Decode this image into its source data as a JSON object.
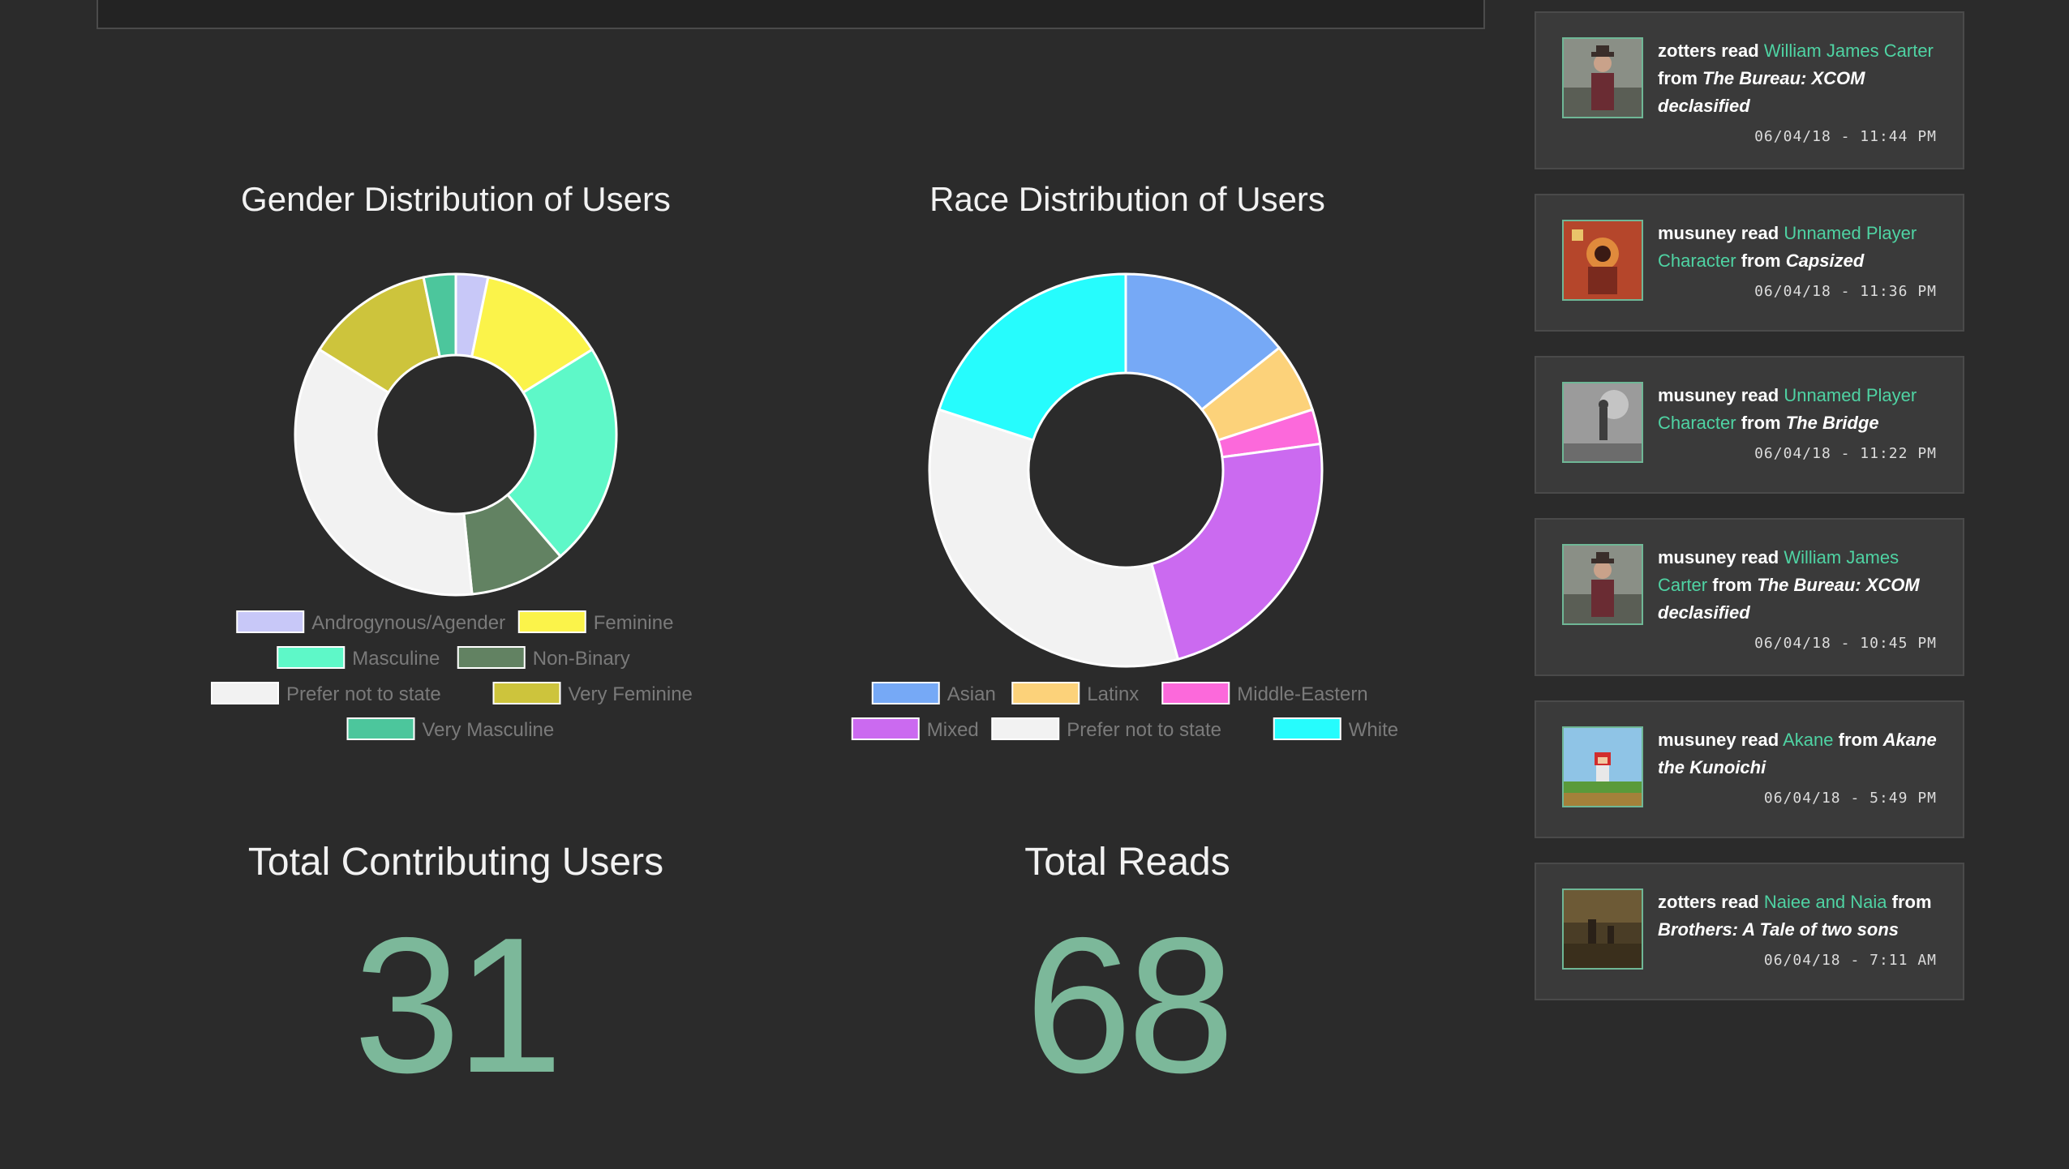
{
  "gender_chart": {
    "title": "Gender Distribution of Users",
    "slices": [
      {
        "label": "Androgynous/Agender",
        "value": 1,
        "color": "#c8c8f8"
      },
      {
        "label": "Feminine",
        "value": 4,
        "color": "#fbf34a"
      },
      {
        "label": "Masculine",
        "value": 7,
        "color": "#5ef8c8"
      },
      {
        "label": "Non-Binary",
        "value": 3,
        "color": "#628262"
      },
      {
        "label": "Prefer not to state",
        "value": 11,
        "color": "#f2f2f2"
      },
      {
        "label": "Very Feminine",
        "value": 4,
        "color": "#cdc43c"
      },
      {
        "label": "Very Masculine",
        "value": 1,
        "color": "#4cc69c"
      }
    ]
  },
  "race_chart": {
    "title": "Race Distribution of Users",
    "slices": [
      {
        "label": "Asian",
        "value": 5,
        "color": "#76a9f6"
      },
      {
        "label": "Latinx",
        "value": 2,
        "color": "#fcd27a"
      },
      {
        "label": "Middle-Eastern",
        "value": 1,
        "color": "#fc69db"
      },
      {
        "label": "Mixed",
        "value": 8,
        "color": "#cb6af0"
      },
      {
        "label": "Prefer not to state",
        "value": 12,
        "color": "#f2f2f2"
      },
      {
        "label": "White",
        "value": 7,
        "color": "#26fcfd"
      }
    ]
  },
  "stats": {
    "users_label": "Total Contributing Users",
    "users_value": "31",
    "reads_label": "Total Reads",
    "reads_value": "68"
  },
  "feed": [
    {
      "user": "zotters",
      "verb": "read",
      "character": "William James Carter",
      "from": "from",
      "game": "The Bureau: XCOM declasified",
      "time": "06/04/18 - 11:44 PM",
      "thumb": "agent-portrait-icon"
    },
    {
      "user": "musuney",
      "verb": "read",
      "character": "Unnamed Player Character",
      "from": "from",
      "game": "Capsized",
      "time": "06/04/18 - 11:36 PM",
      "thumb": "space-explorer-icon"
    },
    {
      "user": "musuney",
      "verb": "read",
      "character": "Unnamed Player Character",
      "from": "from",
      "game": "The Bridge",
      "time": "06/04/18 - 11:22 PM",
      "thumb": "sketch-figure-icon"
    },
    {
      "user": "musuney",
      "verb": "read",
      "character": "William James Carter",
      "from": "from",
      "game": "The Bureau: XCOM declasified",
      "time": "06/04/18 - 10:45 PM",
      "thumb": "agent-portrait-icon"
    },
    {
      "user": "musuney",
      "verb": "read",
      "character": "Akane",
      "from": "from",
      "game": "Akane the Kunoichi",
      "time": "06/04/18 - 5:49 PM",
      "thumb": "pixel-ninja-icon"
    },
    {
      "user": "zotters",
      "verb": "read",
      "character": "Naiee and Naia",
      "from": "from",
      "game": "Brothers: A Tale of two sons",
      "time": "06/04/18 - 7:11 AM",
      "thumb": "brothers-scene-icon"
    }
  ],
  "chart_data": [
    {
      "type": "pie",
      "title": "Gender Distribution of Users",
      "categories": [
        "Androgynous/Agender",
        "Feminine",
        "Masculine",
        "Non-Binary",
        "Prefer not to state",
        "Very Feminine",
        "Very Masculine"
      ],
      "values": [
        1,
        4,
        7,
        3,
        11,
        4,
        1
      ],
      "legend": "bottom"
    },
    {
      "type": "pie",
      "title": "Race Distribution of Users",
      "categories": [
        "Asian",
        "Latinx",
        "Middle-Eastern",
        "Mixed",
        "Prefer not to state",
        "White"
      ],
      "values": [
        5,
        2,
        1,
        8,
        12,
        7
      ],
      "legend": "bottom"
    }
  ]
}
